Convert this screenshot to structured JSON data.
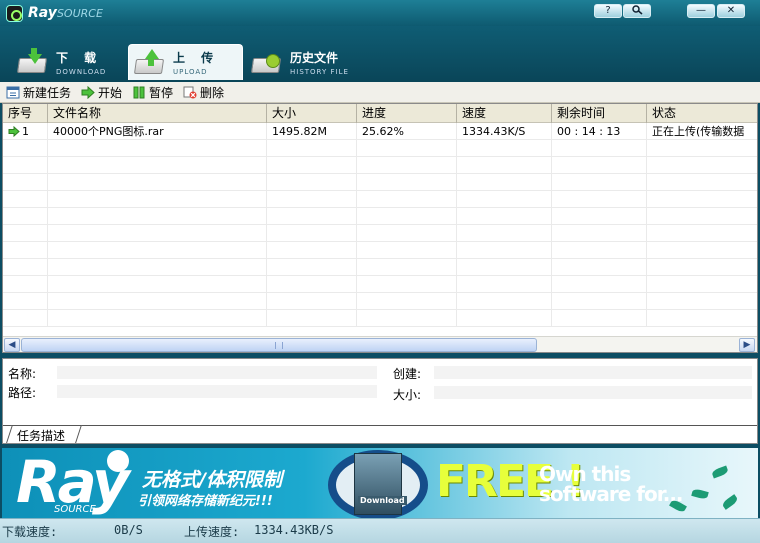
{
  "window": {
    "logo_ray": "Ray",
    "logo_source": "SOURCE",
    "title_buttons": {
      "help": "?",
      "search_icon": "magnifier-icon",
      "minimize": "—",
      "close": "✕"
    }
  },
  "tabs": [
    {
      "cn": "下 载",
      "en": "DOWNLOAD",
      "active": false
    },
    {
      "cn": "上 传",
      "en": "UPLOAD",
      "active": true
    },
    {
      "cn": "历史文件",
      "en": "HISTORY FILE",
      "active": false
    }
  ],
  "toolbar": {
    "new_task": "新建任务",
    "start": "开始",
    "pause": "暂停",
    "delete": "删除"
  },
  "table": {
    "columns": [
      "序号",
      "文件名称",
      "大小",
      "进度",
      "速度",
      "剩余时间",
      "状态"
    ],
    "rows": [
      [
        "1",
        "40000个PNG图标.rar",
        "1495.82M",
        "25.62%",
        "1334.43K/S",
        "00 : 14 : 13",
        "正在上传(传输数据"
      ]
    ]
  },
  "details": {
    "name_label": "名称:",
    "path_label": "路径:",
    "created_label": "创建:",
    "size_label": "大小:",
    "tab_label": "任务描述"
  },
  "banner": {
    "ray": "Ray",
    "source": "SOURCE",
    "cn_line1": "无格式/体积限制",
    "cn_line2": "引领网络存储新纪元!!!",
    "box_label": "Download",
    "free": "FREE !",
    "own_line1": "Own this",
    "own_line2": "software for..."
  },
  "status": {
    "download_label": "下载速度:",
    "download_value": "0B/S",
    "upload_label": "上传速度:",
    "upload_value": "1334.43KB/S"
  },
  "colors": {
    "titlebar": "#1e7f96",
    "accent_green": "#4cc23c",
    "free_yellow": "#e7ff3b"
  }
}
